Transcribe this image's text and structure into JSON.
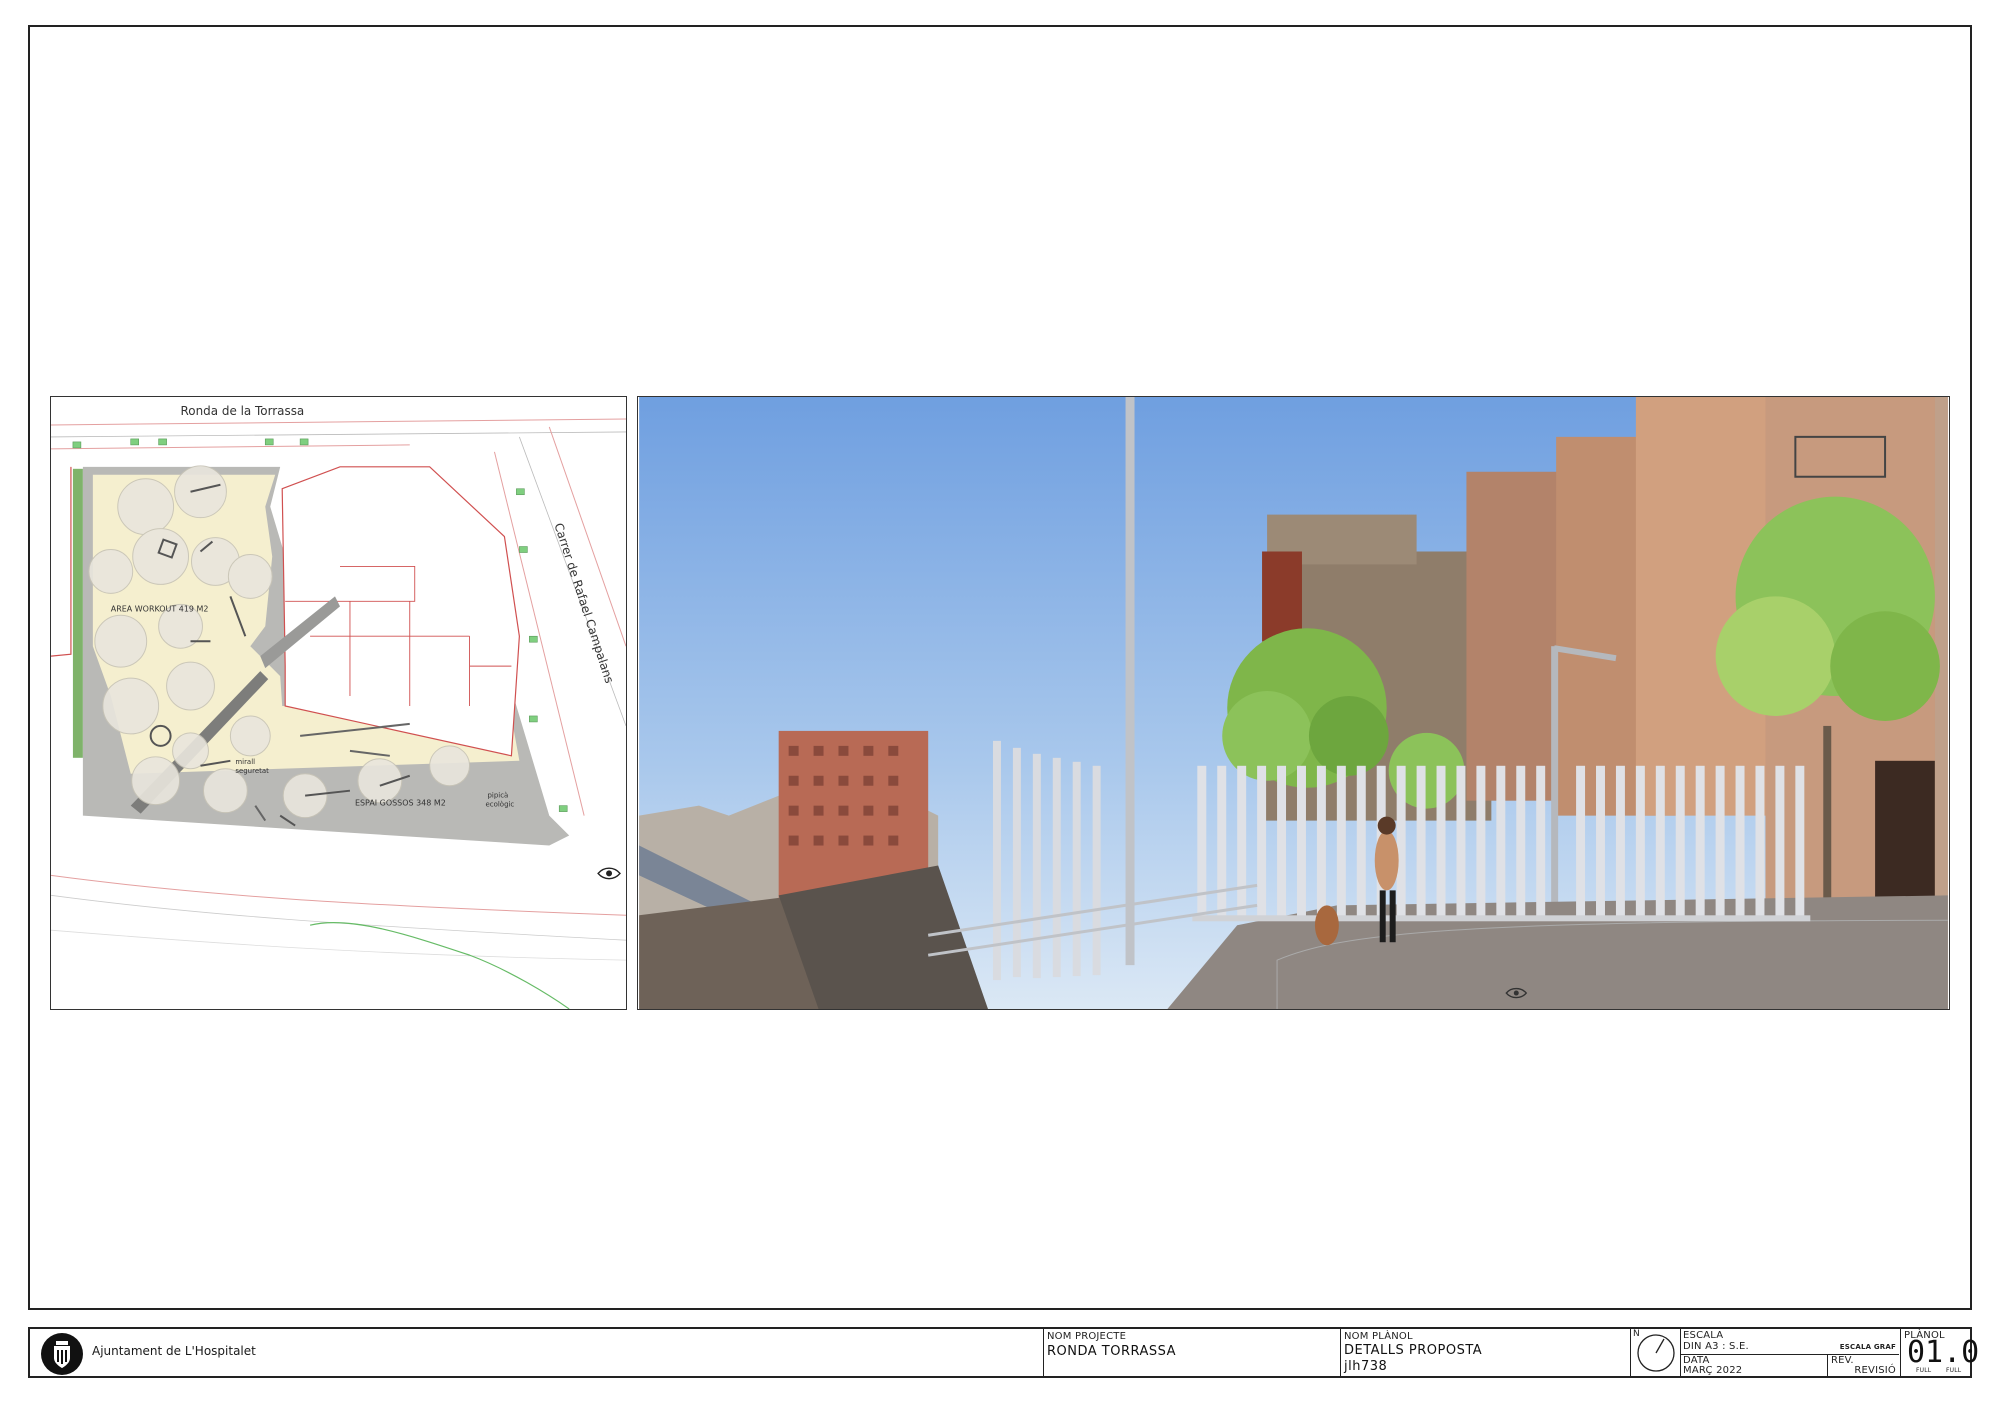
{
  "plan": {
    "street_top": "Ronda de la Torrassa",
    "street_right": "Carrer de Rafael Campalans",
    "area_workout": "AREA WORKOUT 419 M2",
    "area_dogs": "ESPAI GOSSOS 348 M2",
    "mirror_label_1": "mirall",
    "mirror_label_2": "seguretat",
    "pipi_label_1": "pipicà",
    "pipi_label_2": "ecològic"
  },
  "title_block": {
    "organization": "Ajuntament de L'Hospitalet",
    "project_label": "NOM PROJECTE",
    "project_value": "RONDA TORRASSA",
    "plan_label": "NOM PLÀNOL",
    "plan_value": "DETALLS PROPOSTA",
    "plan_code": "jlh738",
    "north_label": "N",
    "scale_label": "ESCALA",
    "scale_value": "DIN A3 : S.E.",
    "scale_graph_label": "ESCALA GRAF",
    "date_label": "DATA",
    "date_value": "MARÇ 2022",
    "rev_label": "REV.",
    "revision_label": "REVISIÓ",
    "sheet_label": "PLÀNOL",
    "sheet_number": "01.0",
    "sheet_full": "FULL",
    "sheet_full_total": "FULL"
  }
}
